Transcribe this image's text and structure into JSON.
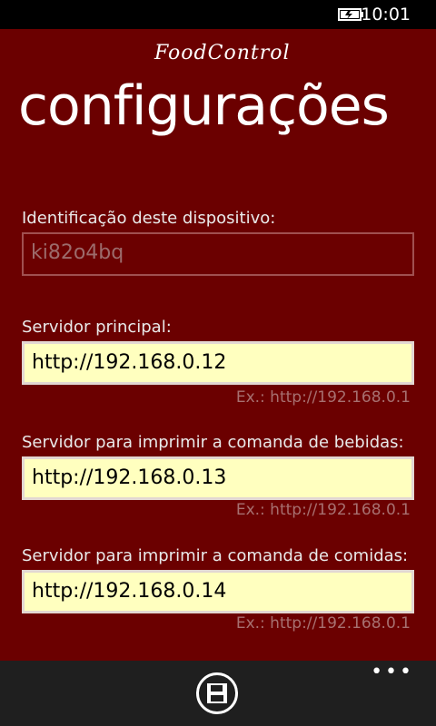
{
  "status": {
    "time": "10:01"
  },
  "app": {
    "logo": "FoodControl",
    "title": "configurações"
  },
  "fields": [
    {
      "label": "Identificação deste dispositivo:",
      "value": "ki82o4bq",
      "hint": "",
      "enabled": false
    },
    {
      "label": "Servidor principal:",
      "value": "http://192.168.0.12",
      "hint": "Ex.: http://192.168.0.1",
      "enabled": true
    },
    {
      "label": "Servidor para imprimir a comanda de bebidas:",
      "value": "http://192.168.0.13",
      "hint": "Ex.: http://192.168.0.1",
      "enabled": true
    },
    {
      "label": "Servidor para imprimir a comanda de comidas:",
      "value": "http://192.168.0.14",
      "hint": "Ex.: http://192.168.0.1",
      "enabled": true
    }
  ],
  "appbar": {
    "more": "•••",
    "save_icon": "save-icon"
  },
  "colors": {
    "background": "#6b0000",
    "field_bg": "#ffffbf",
    "hint": "#a77070",
    "appbar": "#1f1f1f"
  }
}
